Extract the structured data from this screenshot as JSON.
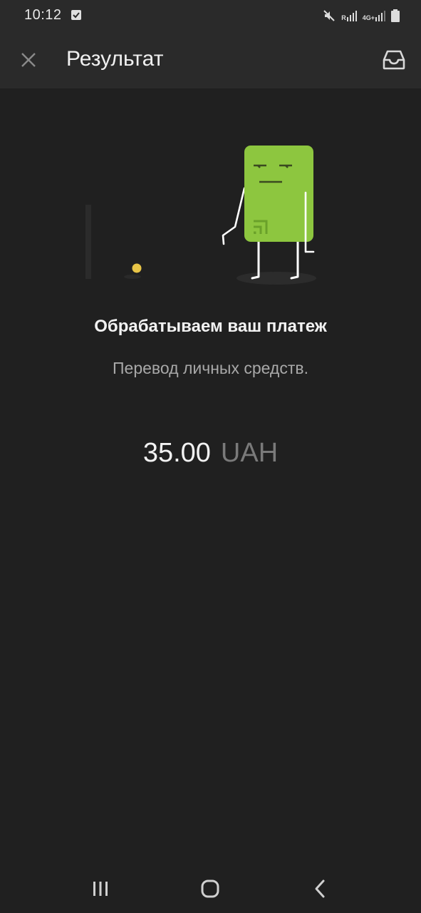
{
  "status_bar": {
    "time": "10:12",
    "network_label_1": "R",
    "network_label_2": "4G+",
    "icons": [
      "check-notification-icon",
      "mute-icon",
      "signal-icon",
      "signal-icon",
      "battery-icon"
    ]
  },
  "app_bar": {
    "title": "Результат",
    "close_icon": "close-icon",
    "inbox_icon": "inbox-icon"
  },
  "illustration": {
    "character_color": "#8dc63f",
    "coin_color": "#e8c547"
  },
  "content": {
    "title": "Обрабатываем ваш платеж",
    "subtitle": "Перевод личных средств.",
    "amount": "35.00",
    "currency": "UAH"
  },
  "nav_bar": {
    "icons": [
      "recent-apps-icon",
      "home-icon",
      "back-icon"
    ]
  }
}
